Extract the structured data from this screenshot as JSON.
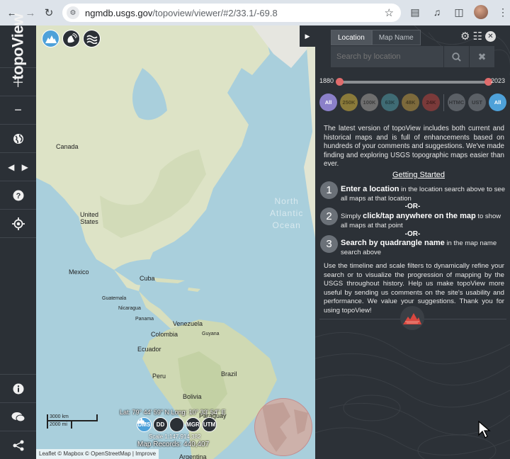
{
  "browser": {
    "url_host": "ngmdb.usgs.gov",
    "url_path": "/topoview/viewer/#2/33.1/-69.8"
  },
  "sidebar": {
    "logo_text": "topoView",
    "buttons": [
      "zoom-in",
      "zoom-out",
      "globe",
      "history",
      "help",
      "locate",
      "info",
      "comments",
      "share"
    ]
  },
  "map": {
    "labels": {
      "canada": "Canada",
      "united_states": "United\nStates",
      "mexico": "Mexico",
      "cuba": "Cuba",
      "guatemala": "Guatemala",
      "nicaragua": "Nicaragua",
      "panama": "Panama",
      "venezuela": "Venezuela",
      "colombia": "Colombia",
      "guyana": "Guyana",
      "ecuador": "Ecuador",
      "peru": "Peru",
      "brazil": "Brazil",
      "bolivia": "Bolivia",
      "paraguay": "Paraguay",
      "argentina": "Argentina"
    },
    "ghost_text": "North\nAtlantic\nOcean",
    "coords": "Lat: 79° 44' 59\" N   Long: 10° 33' 54\" E",
    "coord_buttons": [
      "DMS",
      "DD",
      "",
      "MGR",
      "UTM"
    ],
    "scale_text": "Scale 1:147,914,382",
    "records": "Map Records: 440,407",
    "scalebar_km": "3000 km",
    "scalebar_mi": "2000 mi",
    "attribution": "Leaflet © Mapbox © OpenStreetMap | Improve"
  },
  "panel": {
    "tabs": [
      "Location",
      "Map Name"
    ],
    "search_placeholder": "Search by location",
    "timeline": {
      "start": "1880",
      "end": "2023",
      "range": [
        1880,
        2023
      ]
    },
    "scale_filters": [
      {
        "label": "All",
        "color": "#8b80c9",
        "text": "#ffffff"
      },
      {
        "label": "250K",
        "color": "#8a7a3a"
      },
      {
        "label": "100K",
        "color": "#6e6e6e"
      },
      {
        "label": "63K",
        "color": "#3f6b74"
      },
      {
        "label": "48K",
        "color": "#7d6a3c"
      },
      {
        "label": "24K",
        "color": "#7a3a3a"
      },
      {
        "label": "HTMC",
        "color": "#5b6066"
      },
      {
        "label": "UST",
        "color": "#5b6066"
      },
      {
        "label": "All",
        "color": "#4ea1d9",
        "text": "#ffffff"
      }
    ],
    "intro": "The latest version of topoView includes both current and historical maps and is full of enhancements based on hundreds of your comments and suggestions. We've made finding and exploring USGS topographic maps easier than ever.",
    "getting_started": "Getting Started",
    "steps": [
      {
        "num": "1",
        "bold": "Enter a location",
        "rest": " in the location search above to see all maps at that location"
      },
      {
        "num": "2",
        "pre": "Simply ",
        "bold": "click/tap anywhere on the map",
        "rest": " to show all maps at that point"
      },
      {
        "num": "3",
        "bold": "Search by quadrangle name",
        "rest": " in the map name search above"
      }
    ],
    "or_text": "-OR-",
    "outro": "Use the timeline and scale filters to dynamically refine your search or to visualize the progression of mapping by the USGS throughout history. Help us make topoView more useful by sending us comments on the site's usability and performance. We value your suggestions. Thank you for using topoView!"
  }
}
